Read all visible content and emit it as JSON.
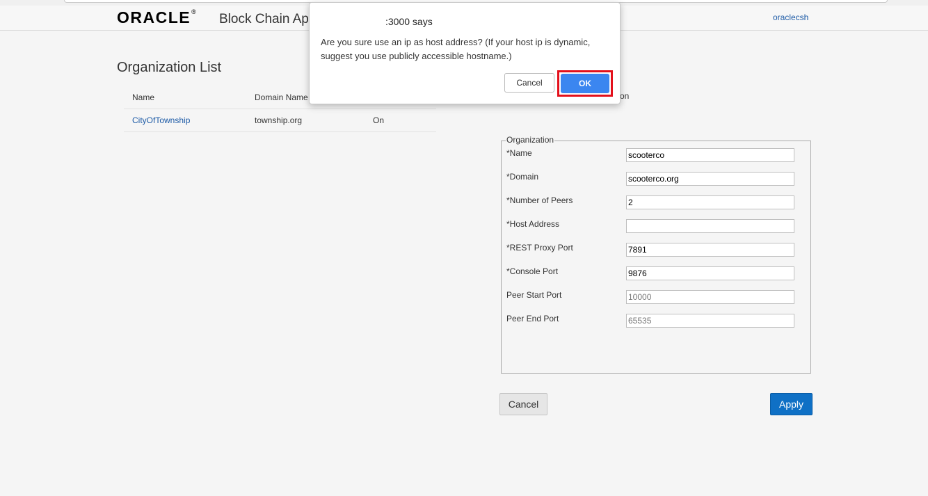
{
  "header": {
    "logo_text": "ORACLE",
    "logo_mark": "®",
    "app_title": "Block Chain App",
    "user": "oraclecsh"
  },
  "main": {
    "page_title": "Organization List",
    "table": {
      "columns": [
        "Name",
        "Domain Name",
        ""
      ],
      "rows": [
        [
          "CityOfTownship",
          "township.org",
          "On"
        ]
      ]
    },
    "right_column_header_partial": "on"
  },
  "form": {
    "legend": "Organization",
    "fields": [
      {
        "label": "*Name",
        "value": "scooterco"
      },
      {
        "label": "*Domain",
        "value": "scooterco.org"
      },
      {
        "label": "*Number of Peers",
        "value": "2"
      },
      {
        "label": "*Host Address",
        "value": ""
      },
      {
        "label": "*REST Proxy Port",
        "value": "7891"
      },
      {
        "label": "*Console Port",
        "value": "9876"
      },
      {
        "label": "Peer Start Port",
        "value": "10000"
      },
      {
        "label": "Peer End Port",
        "value": "65535"
      }
    ],
    "cancel_label": "Cancel",
    "apply_label": "Apply"
  },
  "dialog": {
    "title": ":3000 says",
    "message": "Are you sure use an ip as host address? (If your host ip is dynamic, suggest you use publicly accessible hostname.)",
    "cancel_label": "Cancel",
    "ok_label": "OK"
  },
  "colors": {
    "link": "#1c5aa6",
    "primary": "#0f70c5",
    "dialog_ok": "#3b86f0",
    "highlight": "#e3101b"
  }
}
